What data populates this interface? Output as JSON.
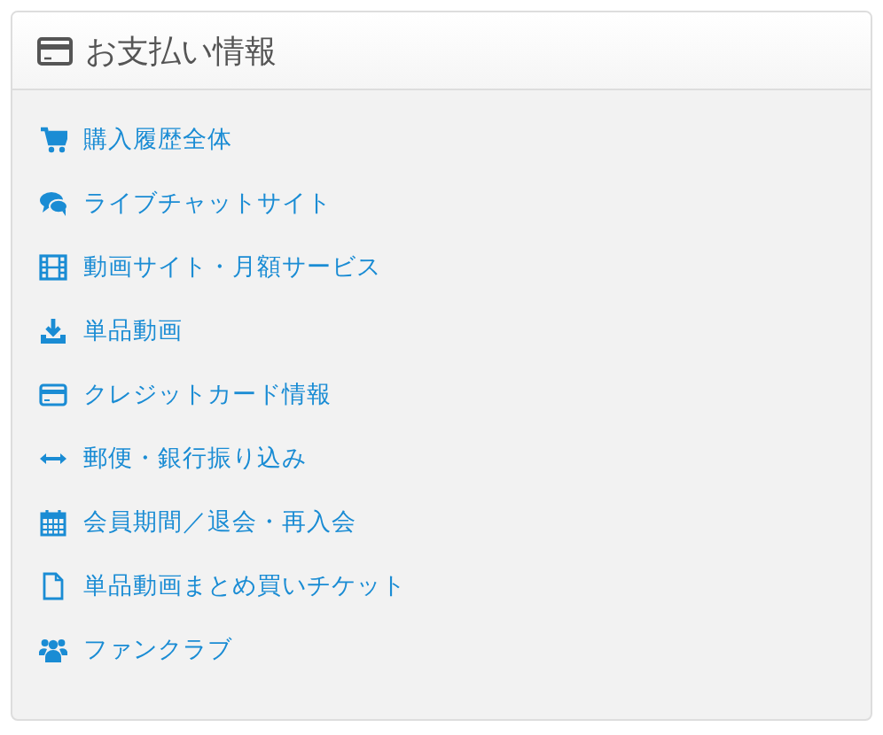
{
  "panel": {
    "title": "お支払い情報"
  },
  "links": [
    {
      "label": "購入履歴全体"
    },
    {
      "label": "ライブチャットサイト"
    },
    {
      "label": "動画サイト・月額サービス"
    },
    {
      "label": "単品動画"
    },
    {
      "label": "クレジットカード情報"
    },
    {
      "label": "郵便・銀行振り込み"
    },
    {
      "label": "会員期間／退会・再入会"
    },
    {
      "label": "単品動画まとめ買いチケット"
    },
    {
      "label": "ファンクラブ"
    }
  ]
}
